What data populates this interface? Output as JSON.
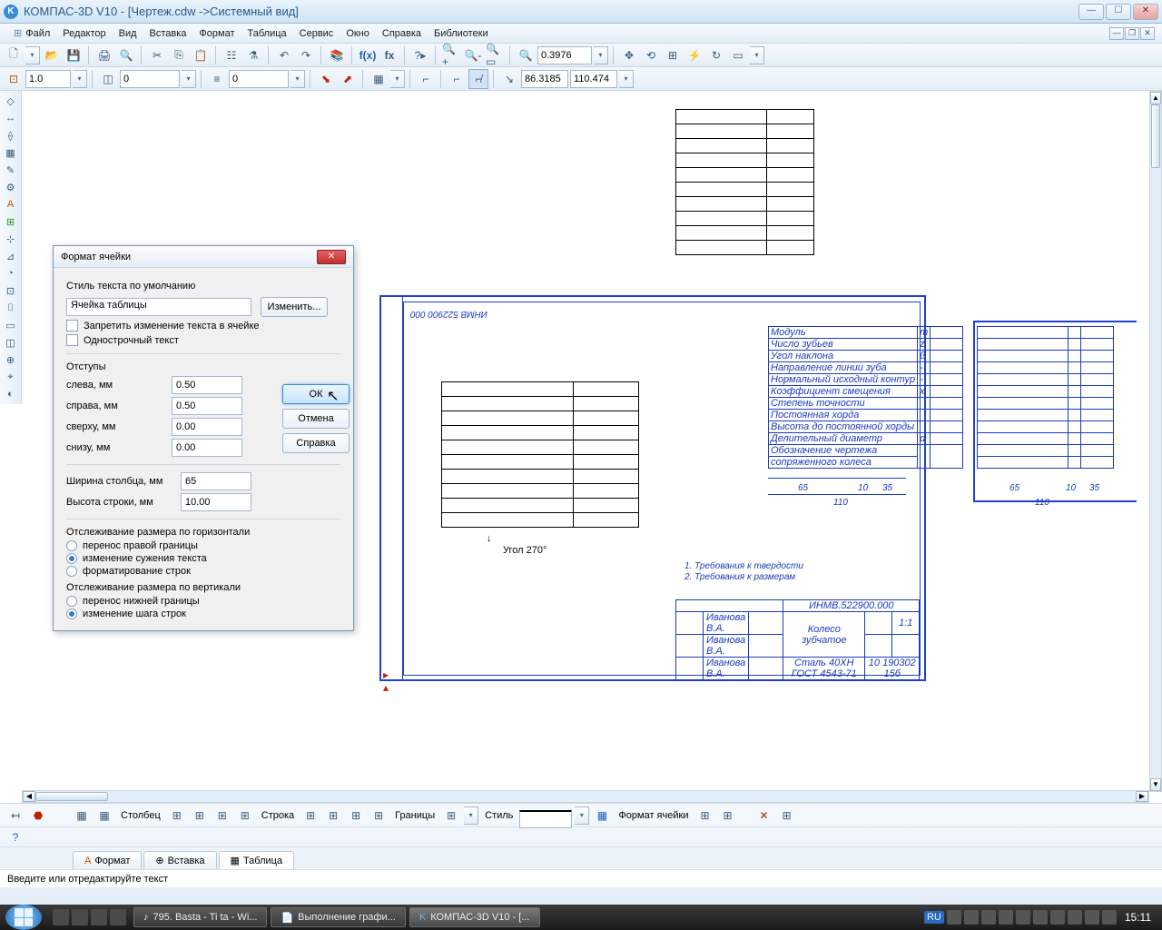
{
  "title": "КОМПАС-3D V10 - [Чертеж.cdw ->Системный вид]",
  "menu": [
    "Файл",
    "Редактор",
    "Вид",
    "Вставка",
    "Формат",
    "Таблица",
    "Сервис",
    "Окно",
    "Справка",
    "Библиотеки"
  ],
  "toolbar2": {
    "zoom": "0.3976"
  },
  "toolbar3": {
    "v1": "1.0",
    "v2": "0",
    "v3": "0",
    "cx": "86.3185",
    "cy": "110.474"
  },
  "dialog": {
    "title": "Формат ячейки",
    "style_group": "Стиль текста по умолчанию",
    "style_value": "Ячейка таблицы",
    "btn_change": "Изменить...",
    "cb_lock": "Запретить изменение текста в ячейке",
    "cb_single": "Однострочный текст",
    "indents": "Отступы",
    "left": "слева, мм",
    "left_v": "0.50",
    "right": "справа, мм",
    "right_v": "0.50",
    "top": "сверху, мм",
    "top_v": "0.00",
    "bottom": "снизу, мм",
    "bottom_v": "0.00",
    "col_w": "Ширина столбца, мм",
    "col_w_v": "65",
    "row_h": "Высота строки, мм",
    "row_h_v": "10.00",
    "track_h": "Отслеживание размера по горизонтали",
    "rh1": "перенос правой границы",
    "rh2": "изменение сужения текста",
    "rh3": "форматирование строк",
    "track_v": "Отслеживание размера по вертикали",
    "rv1": "перенос нижней границы",
    "rv2": "изменение шага строк",
    "ok": "ОК",
    "cancel": "Отмена",
    "help": "Справка"
  },
  "canvas": {
    "angle": "Угол 270°",
    "code_v": "ИНМВ 522900 000",
    "req1": "1. Требования к твердости",
    "req2": "2. Требования к размерам",
    "params": [
      "Модуль",
      "Число зубьев",
      "Угол наклона",
      "Направление линии зуба",
      "Нормальный исходный контур",
      "Коэффициент смещения",
      "Степень точности",
      "Постоянная хорда",
      "Высота до постоянной хорды",
      "Делительный диаметр",
      "Обозначение чертежа",
      "сопряженного колеса"
    ],
    "param_sym": [
      "m",
      "z",
      "β",
      "-",
      "-",
      "x",
      "",
      "",
      "",
      "d",
      "",
      ""
    ],
    "dims": {
      "d65": "65",
      "d10": "10",
      "d35": "35",
      "d110": "110"
    },
    "stamp": {
      "code": "ИНМВ.522900.000",
      "name1": "Колесо",
      "name2": "зубчатое",
      "mat1": "Сталь 40ХН",
      "mat2": "ГОСТ 4543-71",
      "scale": "1:1",
      "sheet": "10 190302 15б",
      "who": "Иванова В.А."
    }
  },
  "bottom": {
    "col": "Столбец",
    "row": "Строка",
    "borders": "Границы",
    "style": "Стиль",
    "cellfmt": "Формат ячейки",
    "tabs": [
      "Формат",
      "Вставка",
      "Таблица"
    ]
  },
  "status": "Введите или отредактируйте текст",
  "taskbar": {
    "t1": "795. Basta - Ti ta - Wi...",
    "t2": "Выполнение графи...",
    "t3": "КОМПАС-3D V10 - [...",
    "lang": "RU",
    "clock": "15:11"
  }
}
